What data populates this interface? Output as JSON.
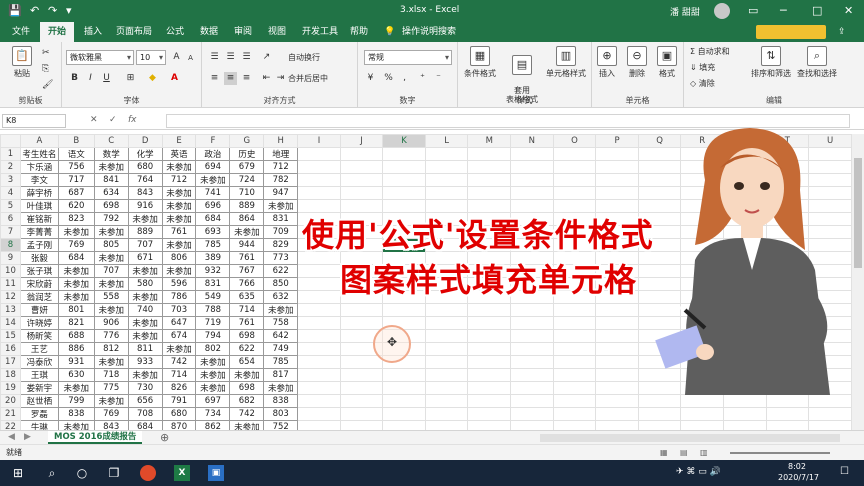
{
  "window": {
    "title": "3.xlsx  -  Excel",
    "user": "潘 甜甜",
    "controls": [
      "─",
      "□",
      "✕"
    ]
  },
  "ribbon_tabs": [
    "文件",
    "开始",
    "插入",
    "页面布局",
    "公式",
    "数据",
    "审阅",
    "视图",
    "开发工具",
    "帮助",
    "操作说明搜索"
  ],
  "active_tab": "开始",
  "ribbon": {
    "clipboard": {
      "label": "剪贴板",
      "paste": "粘贴"
    },
    "font": {
      "label": "字体",
      "family": "微软雅黑",
      "size": "10",
      "bold": "B",
      "italic": "I",
      "underline": "U",
      "grow": "A",
      "shrink": "A"
    },
    "alignment": {
      "label": "对齐方式",
      "wrap": "自动换行",
      "merge": "合并后居中"
    },
    "number": {
      "label": "数字",
      "format": "常规",
      "percent": "%",
      "comma": ",",
      "currency": "¥"
    },
    "styles": {
      "label": "样式",
      "conditional": "条件格式",
      "table": "套用\n表格格式",
      "cell": "单元格样式"
    },
    "cells": {
      "label": "单元格",
      "insert": "插入",
      "delete": "删除",
      "format": "格式"
    },
    "editing": {
      "label": "编辑",
      "autosum": "自动求和",
      "fill": "填充",
      "clear": "清除",
      "sort": "排序和筛选",
      "find": "查找和选择"
    }
  },
  "formula_bar": {
    "name_box": "K8",
    "fx": "fx",
    "value": ""
  },
  "columns": [
    "A",
    "B",
    "C",
    "D",
    "E",
    "F",
    "G",
    "H",
    "I",
    "J",
    "K",
    "L",
    "M",
    "N",
    "O",
    "P",
    "Q",
    "R",
    "S",
    "T",
    "U"
  ],
  "selected_column": "K",
  "selected_row": 8,
  "rows": [
    [
      "考生姓名",
      "语文",
      "数学",
      "化学",
      "英语",
      "政治",
      "历史",
      "地理"
    ],
    [
      "卞乐涵",
      "756",
      "未参加",
      "680",
      "未参加",
      "694",
      "679",
      "712"
    ],
    [
      "李文",
      "717",
      "841",
      "764",
      "712",
      "未参加",
      "724",
      "782"
    ],
    [
      "薛宇桥",
      "687",
      "634",
      "843",
      "未参加",
      "741",
      "710",
      "947"
    ],
    [
      "叶佳琪",
      "620",
      "698",
      "916",
      "未参加",
      "696",
      "889",
      "未参加"
    ],
    [
      "崔铭新",
      "823",
      "792",
      "未参加",
      "未参加",
      "684",
      "864",
      "831"
    ],
    [
      "李菁菁",
      "未参加",
      "未参加",
      "889",
      "761",
      "693",
      "未参加",
      "709"
    ],
    [
      "孟子刚",
      "769",
      "805",
      "707",
      "未参加",
      "785",
      "944",
      "829"
    ],
    [
      "张毅",
      "684",
      "未参加",
      "671",
      "806",
      "389",
      "761",
      "773"
    ],
    [
      "张子琪",
      "未参加",
      "707",
      "未参加",
      "未参加",
      "932",
      "767",
      "622"
    ],
    [
      "宋欣蔚",
      "未参加",
      "未参加",
      "580",
      "596",
      "831",
      "766",
      "850"
    ],
    [
      "翁润芝",
      "未参加",
      "558",
      "未参加",
      "786",
      "549",
      "635",
      "632"
    ],
    [
      "曹妍",
      "801",
      "未参加",
      "740",
      "703",
      "788",
      "714",
      "未参加"
    ],
    [
      "许晓婷",
      "821",
      "906",
      "未参加",
      "647",
      "719",
      "761",
      "758"
    ],
    [
      "杨昕笑",
      "688",
      "776",
      "未参加",
      "674",
      "794",
      "698",
      "642"
    ],
    [
      "王艺",
      "886",
      "812",
      "811",
      "未参加",
      "802",
      "622",
      "749"
    ],
    [
      "冯泰欣",
      "931",
      "未参加",
      "933",
      "742",
      "未参加",
      "654",
      "785"
    ],
    [
      "王琪",
      "630",
      "718",
      "未参加",
      "714",
      "未参加",
      "未参加",
      "817"
    ],
    [
      "娄新宇",
      "未参加",
      "775",
      "730",
      "826",
      "未参加",
      "698",
      "未参加"
    ],
    [
      "赵世栖",
      "799",
      "未参加",
      "656",
      "791",
      "697",
      "682",
      "838"
    ],
    [
      "罗磊",
      "838",
      "769",
      "708",
      "680",
      "734",
      "742",
      "803"
    ],
    [
      "牛琳",
      "未参加",
      "843",
      "684",
      "870",
      "862",
      "未参加",
      "752"
    ]
  ],
  "sheet_tab": "MOS 2016成绩报告",
  "status": "就绪",
  "overlay": {
    "line1": "使用'公式'设置条件格式",
    "line2": "图案样式填充单元格"
  },
  "taskbar": {
    "time": "8:02",
    "date": "2020/7/17"
  }
}
